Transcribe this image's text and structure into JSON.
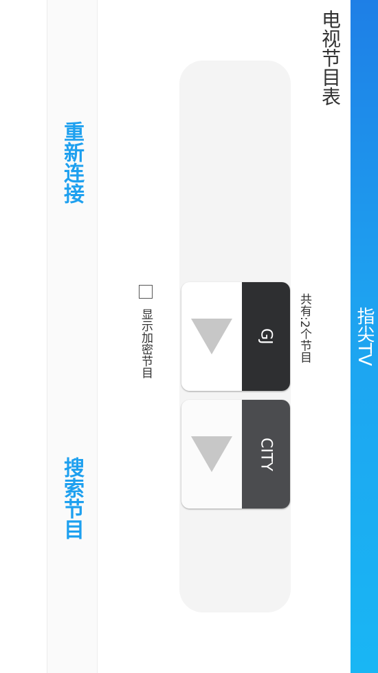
{
  "app": {
    "title": "指尖TV"
  },
  "page": {
    "heading": "电视节目表"
  },
  "channels": {
    "total_label": "共有:2个节目",
    "items": [
      {
        "name": "GJ"
      },
      {
        "name": "CITY"
      }
    ]
  },
  "options": {
    "show_encrypted_label": "显示加密节目",
    "show_encrypted_checked": false
  },
  "actions": {
    "reconnect_label": "重新连接",
    "search_label": "搜索节目"
  },
  "colors": {
    "accent": "#1ea0ef",
    "appbar": "#1e8ff0",
    "channel_dark": "#2e2f31",
    "channel_medium": "#4b4c4f"
  },
  "icons": {
    "play": "play-icon"
  }
}
